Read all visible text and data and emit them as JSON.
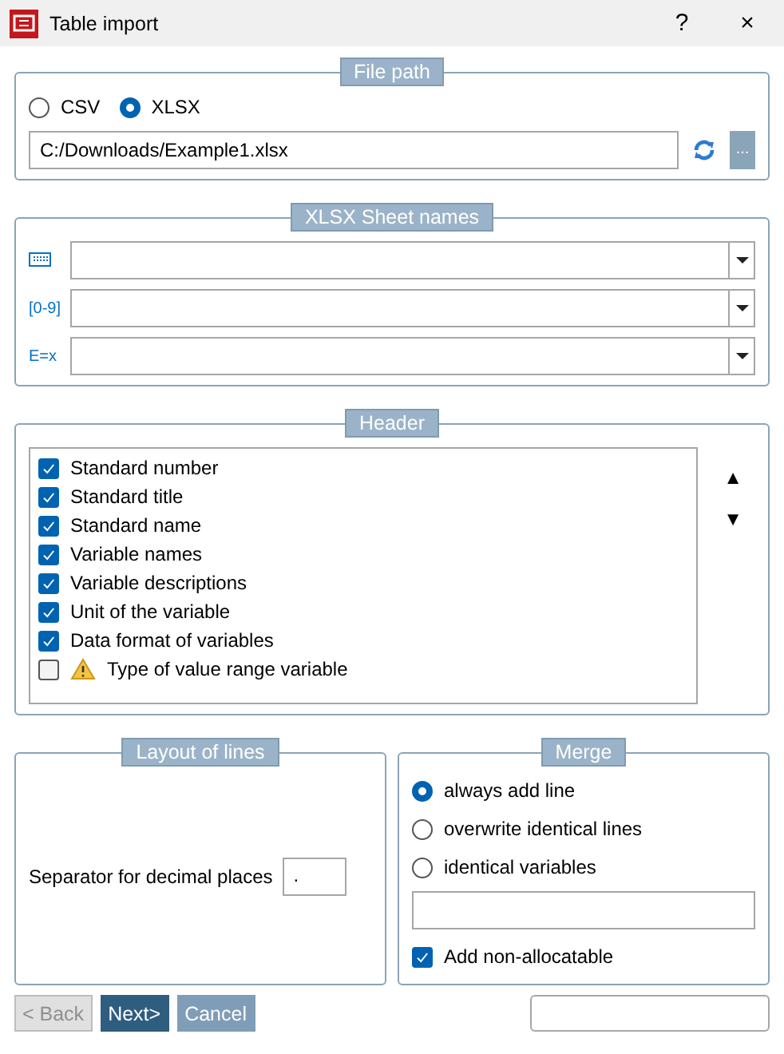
{
  "window": {
    "title": "Table import",
    "help": "?",
    "close": "×"
  },
  "file_path": {
    "title": "File path",
    "formats": [
      {
        "label": "CSV",
        "selected": false
      },
      {
        "label": "XLSX",
        "selected": true
      }
    ],
    "path": "C:/Downloads/Example1.xlsx",
    "browse": "..."
  },
  "sheet_names": {
    "title": "XLSX Sheet names",
    "rows": [
      {
        "kind": "grid"
      },
      {
        "kind": "text",
        "label": "[0-9]"
      },
      {
        "kind": "text",
        "label": "E=x"
      }
    ]
  },
  "header": {
    "title": "Header",
    "items": [
      {
        "label": "Standard number",
        "checked": true,
        "warning": false
      },
      {
        "label": "Standard title",
        "checked": true,
        "warning": false
      },
      {
        "label": "Standard name",
        "checked": true,
        "warning": false
      },
      {
        "label": "Variable names",
        "checked": true,
        "warning": false
      },
      {
        "label": "Variable descriptions",
        "checked": true,
        "warning": false
      },
      {
        "label": "Unit of the variable",
        "checked": true,
        "warning": false
      },
      {
        "label": "Data format of variables",
        "checked": true,
        "warning": false
      },
      {
        "label": "Type of value range variable",
        "checked": false,
        "warning": true
      }
    ],
    "up": "▲",
    "down": "▼"
  },
  "layout_of_lines": {
    "title": "Layout of lines",
    "separator_label": "Separator for decimal places",
    "separator_value": "."
  },
  "merge": {
    "title": "Merge",
    "options": [
      {
        "label": "always add line",
        "selected": true
      },
      {
        "label": "overwrite identical lines",
        "selected": false
      },
      {
        "label": "identical variables",
        "selected": false
      }
    ],
    "add_non_allocatable": {
      "label": "Add non-allocatable",
      "checked": true
    }
  },
  "buttons": [
    {
      "label": "< Back",
      "disabled": true,
      "kind": "back"
    },
    {
      "label": "Next>",
      "disabled": false,
      "kind": "next"
    },
    {
      "label": "Cancel",
      "disabled": false,
      "kind": "cancel"
    }
  ]
}
